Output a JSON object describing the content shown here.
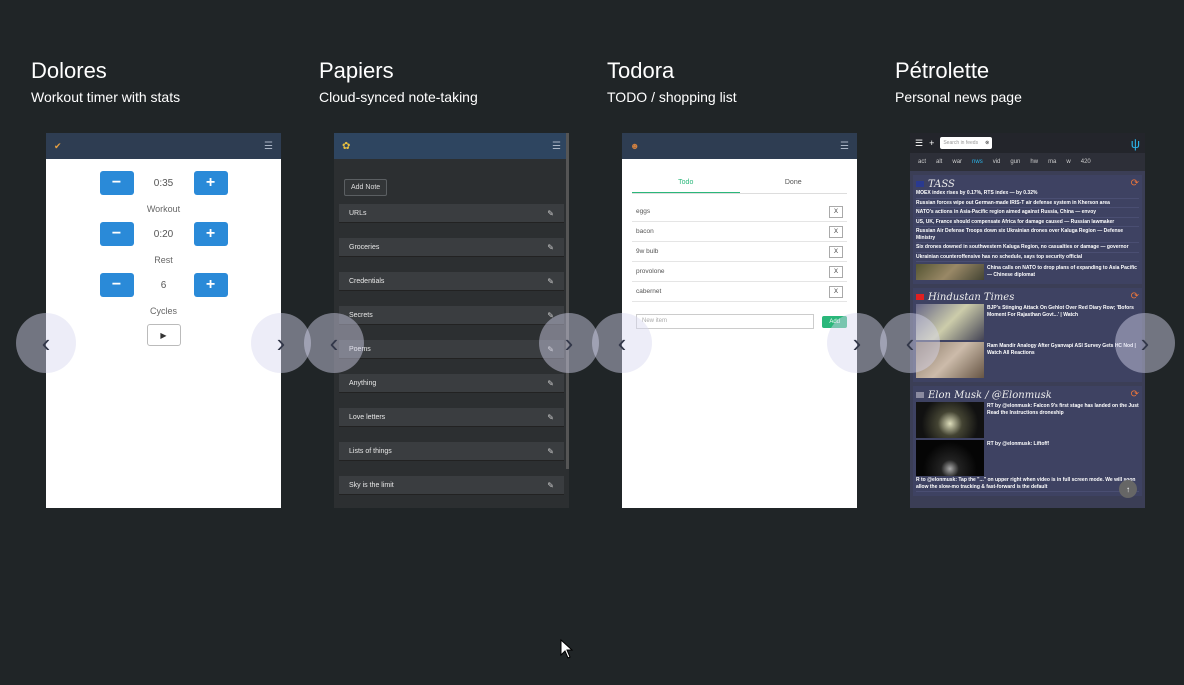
{
  "apps": [
    {
      "title": "Dolores",
      "subtitle": "Workout timer with stats"
    },
    {
      "title": "Papiers",
      "subtitle": "Cloud-synced note-taking"
    },
    {
      "title": "Todora",
      "subtitle": "TODO / shopping list"
    },
    {
      "title": "Pétrolette",
      "subtitle": "Personal news page"
    }
  ],
  "arrows": {
    "prev": "‹",
    "next": "›"
  },
  "dolores": {
    "rows": [
      {
        "value": "0:35",
        "label": "Workout"
      },
      {
        "value": "0:20",
        "label": "Rest"
      },
      {
        "value": "6",
        "label": "Cycles"
      }
    ],
    "minus": "−",
    "plus": "+",
    "play": "▶"
  },
  "papiers": {
    "add_note": "Add Note",
    "notes": [
      "URLs",
      "Groceries",
      "Credentials",
      "Secrets",
      "Poems",
      "Anything",
      "Love letters",
      "Lists of things",
      "Sky is the limit"
    ]
  },
  "todora": {
    "tabs": [
      "Todo",
      "Done"
    ],
    "items": [
      "eggs",
      "bacon",
      "9w bulb",
      "provolone",
      "cabernet"
    ],
    "remove": "X",
    "new_placeholder": "New item",
    "add_label": "Add"
  },
  "petrolette": {
    "search_placeholder": "Search in feeds",
    "tabs": [
      "act",
      "alt",
      "war",
      "nws",
      "vid",
      "gun",
      "hw",
      "ma",
      "w",
      "420"
    ],
    "active_tab": "nws",
    "feeds": [
      {
        "name": "TASS",
        "items": [
          "MOEX index rises by 0.17%, RTS index — by 0.32%",
          "Russian forces wipe out German-made IRIS-T air defense system in Kherson area",
          "NATO's actions in Asia-Pacific region aimed against Russia, China — envoy",
          "US, UK, France should compensate Africa for damage caused — Russian lawmaker",
          "Russian Air Defense Troops down six Ukrainian drones over Kaluga Region — Defense Ministry",
          "Six drones downed in southwestern Kaluga Region, no casualties or damage — governor",
          "Ukrainian counteroffensive has no schedule, says top security official",
          "China calls on NATO to drop plans of expanding to Asia Pacific — Chinese diplomat"
        ]
      },
      {
        "name": "Hindustan Times",
        "items": [
          "BJP's Stinging Attack On Gehlot Over Red Diary Row; 'Bofors Moment For Rajasthan Govt...' | Watch",
          "Ram Mandir Analogy After Gyanvapi ASI Survey Gets HC Nod | Watch All Reactions"
        ]
      },
      {
        "name": "Elon Musk / @Elonmusk",
        "items": [
          "RT by @elonmusk: Falcon 9's first stage has landed on the Just Read the Instructions droneship",
          "RT by @elonmusk: Liftoff!",
          "R to @elonmusk: Tap the \"...\" on upper right when video is in full screen mode. We will soon allow the slow-mo tracking & fast-forward is the default"
        ]
      }
    ]
  }
}
